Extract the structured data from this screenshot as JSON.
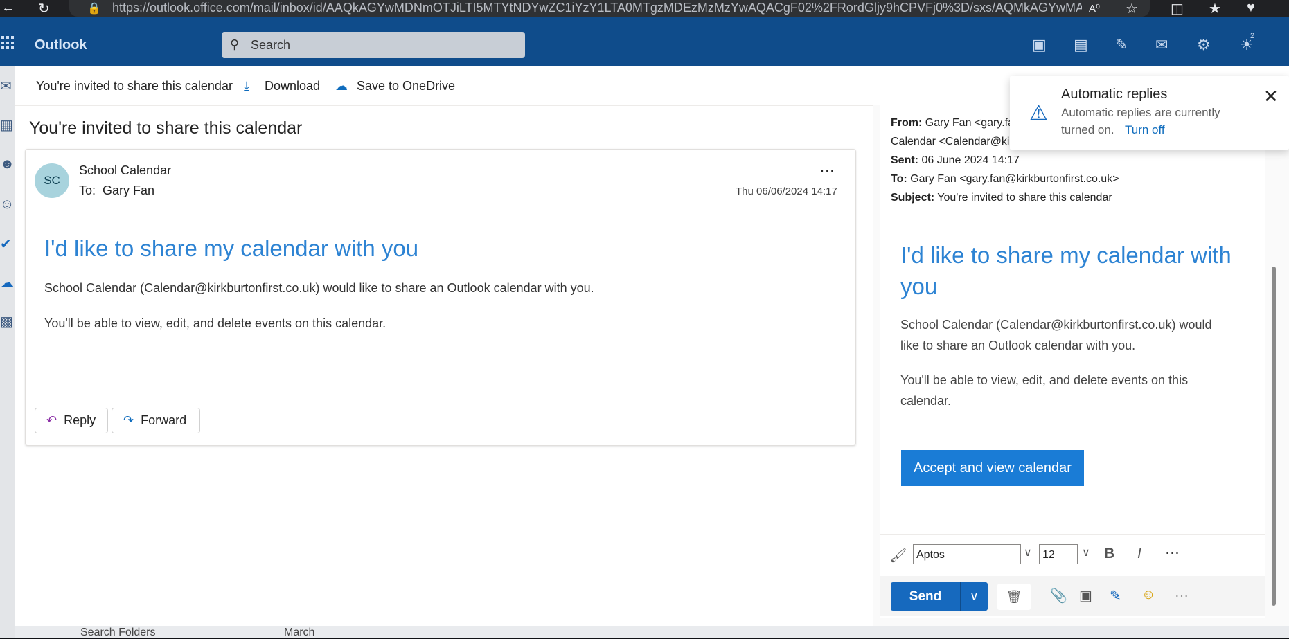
{
  "browser": {
    "url": "https://outlook.office.com/mail/inbox/id/AAQkAGYwMDNmOTJiLTI5MTYtNDYwZC1iYzY1LTA0MTgzMDEzMzMzYwAQACgF02%2FRordGljy9hCPVFj0%3D/sxs/AQMkAGYwMAAzZjkyY..."
  },
  "header": {
    "app_name": "Outlook",
    "search_placeholder": "Search",
    "notification_count": "2"
  },
  "toolbar": {
    "subject_label": "You're invited to share this calendar",
    "download_label": "Download",
    "save_label": "Save to OneDrive"
  },
  "message": {
    "subject": "You're invited to share this calendar",
    "avatar_initials": "SC",
    "sender": "School Calendar",
    "to_prefix": "To:",
    "to": "Gary Fan",
    "date": "Thu 06/06/2024 14:17",
    "more": "...",
    "heading": "I'd like to share my calendar with you",
    "para1": "School Calendar (Calendar@kirkburtonfirst.co.uk) would like to share an Outlook calendar with you.",
    "para2": "You'll be able to view, edit, and delete events on this calendar.",
    "reply_label": "Reply",
    "forward_label": "Forward"
  },
  "compose": {
    "from_label": "From:",
    "from_value": "Gary Fan <gary.fa",
    "from_cont": "Calendar <Calendar@ki",
    "sent_label": "Sent:",
    "sent_value": "06 June 2024 14:17",
    "to_label": "To:",
    "to_value": "Gary Fan <gary.fan@kirkburtonfirst.co.uk>",
    "subject_label": "Subject:",
    "subject_value": "You're invited to share this calendar",
    "heading": "I'd like to share my calendar with you",
    "para1": "School Calendar (Calendar@kirkburtonfirst.co.uk) would like to share an Outlook calendar with you.",
    "para2": "You'll be able to view, edit, and delete events on this calendar.",
    "accept_label": "Accept and view calendar",
    "font_name": "Aptos",
    "font_size": "12",
    "send_label": "Send"
  },
  "toast": {
    "title": "Automatic replies",
    "message_line1": "Automatic replies are currently",
    "message_line2": "turned on.",
    "action": "Turn off"
  },
  "bottom": {
    "folder_label": "Search Folders",
    "month_label": "March"
  },
  "colors": {
    "header_bg": "#0f4c8b",
    "accent": "#1669be",
    "link_blue": "#2d83d3"
  }
}
